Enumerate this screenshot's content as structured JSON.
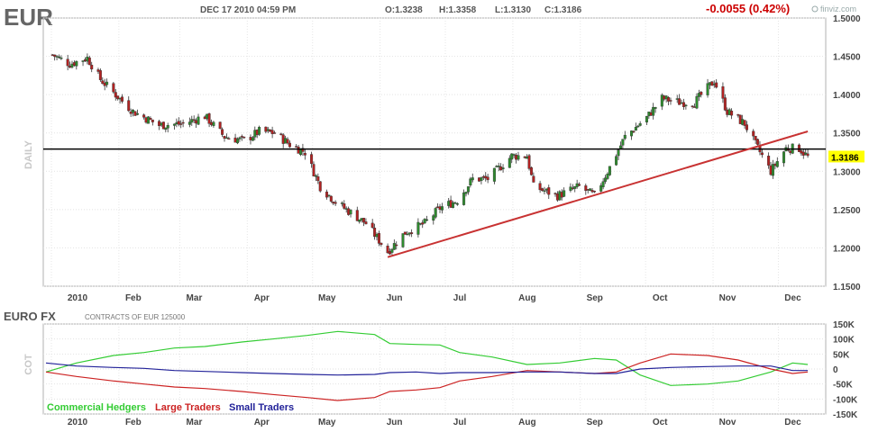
{
  "header": {
    "ticker": "EUR",
    "datetime": "DEC 17 2010 04:59 PM",
    "open": "O:1.3238",
    "high": "H:1.3358",
    "low": "L:1.3130",
    "close": "C:1.3186",
    "change": "-0.0055 (0.42%)",
    "brand": "finviz.com"
  },
  "colors": {
    "up": "#2e8b2e",
    "down": "#b22222",
    "trendline": "#c83232",
    "horizontal": "#000000",
    "commercial": "#33cc33",
    "large": "#cc2222",
    "small": "#222299",
    "change": "#cc0000",
    "price_box": "#ffff00"
  },
  "chart_data": [
    {
      "type": "candlestick",
      "vertical_label": "DAILY",
      "y_ticks": [
        "1.5000",
        "1.4500",
        "1.4000",
        "1.3500",
        "1.3000",
        "1.2500",
        "1.2000",
        "1.1500"
      ],
      "ylim": [
        1.15,
        1.5
      ],
      "x_labels": [
        "2010",
        "Feb",
        "Mar",
        "Apr",
        "May",
        "Jun",
        "Jul",
        "Aug",
        "Sep",
        "Oct",
        "Nov",
        "Dec"
      ],
      "last_price": "1.3186",
      "last_price_value": 1.3186,
      "horizontal_line": 1.329,
      "trendline": {
        "from": {
          "date": "2010-06-07",
          "price": 1.188
        },
        "to": {
          "date": "2010-12-17",
          "price": 1.352
        }
      },
      "anchors": [
        {
          "date": "2010-01-04",
          "price": 1.452
        },
        {
          "date": "2010-01-12",
          "price": 1.44
        },
        {
          "date": "2010-01-20",
          "price": 1.448
        },
        {
          "date": "2010-01-26",
          "price": 1.42
        },
        {
          "date": "2010-02-02",
          "price": 1.4
        },
        {
          "date": "2010-02-10",
          "price": 1.378
        },
        {
          "date": "2010-02-22",
          "price": 1.36
        },
        {
          "date": "2010-03-05",
          "price": 1.362
        },
        {
          "date": "2010-03-15",
          "price": 1.372
        },
        {
          "date": "2010-03-24",
          "price": 1.345
        },
        {
          "date": "2010-04-02",
          "price": 1.34
        },
        {
          "date": "2010-04-09",
          "price": 1.352
        },
        {
          "date": "2010-04-16",
          "price": 1.35
        },
        {
          "date": "2010-04-23",
          "price": 1.335
        },
        {
          "date": "2010-04-30",
          "price": 1.325
        },
        {
          "date": "2010-05-07",
          "price": 1.28
        },
        {
          "date": "2010-05-14",
          "price": 1.26
        },
        {
          "date": "2010-05-20",
          "price": 1.248
        },
        {
          "date": "2010-05-28",
          "price": 1.232
        },
        {
          "date": "2010-06-07",
          "price": 1.195
        },
        {
          "date": "2010-06-15",
          "price": 1.22
        },
        {
          "date": "2010-06-24",
          "price": 1.232
        },
        {
          "date": "2010-07-01",
          "price": 1.252
        },
        {
          "date": "2010-07-09",
          "price": 1.262
        },
        {
          "date": "2010-07-16",
          "price": 1.29
        },
        {
          "date": "2010-07-23",
          "price": 1.29
        },
        {
          "date": "2010-08-03",
          "price": 1.32
        },
        {
          "date": "2010-08-10",
          "price": 1.32
        },
        {
          "date": "2010-08-13",
          "price": 1.28
        },
        {
          "date": "2010-08-24",
          "price": 1.268
        },
        {
          "date": "2010-09-03",
          "price": 1.28
        },
        {
          "date": "2010-09-10",
          "price": 1.268
        },
        {
          "date": "2010-09-17",
          "price": 1.305
        },
        {
          "date": "2010-09-24",
          "price": 1.345
        },
        {
          "date": "2010-10-04",
          "price": 1.37
        },
        {
          "date": "2010-10-11",
          "price": 1.395
        },
        {
          "date": "2010-10-19",
          "price": 1.39
        },
        {
          "date": "2010-10-26",
          "price": 1.39
        },
        {
          "date": "2010-11-04",
          "price": 1.418
        },
        {
          "date": "2010-11-10",
          "price": 1.378
        },
        {
          "date": "2010-11-18",
          "price": 1.362
        },
        {
          "date": "2010-11-23",
          "price": 1.335
        },
        {
          "date": "2010-11-30",
          "price": 1.3
        },
        {
          "date": "2010-12-07",
          "price": 1.33
        },
        {
          "date": "2010-12-13",
          "price": 1.33
        },
        {
          "date": "2010-12-17",
          "price": 1.3186
        }
      ]
    },
    {
      "type": "line",
      "title": "EURO FX",
      "subtitle": "CONTRACTS OF EUR 125000",
      "vertical_label": "COT",
      "y_ticks": [
        "150K",
        "100K",
        "50K",
        "0",
        "-50K",
        "-100K",
        "-150K"
      ],
      "ylim": [
        -150000,
        150000
      ],
      "x_labels": [
        "2010",
        "Feb",
        "Mar",
        "Apr",
        "May",
        "Jun",
        "Jul",
        "Aug",
        "Sep",
        "Oct",
        "Nov",
        "Dec"
      ],
      "series": [
        {
          "name": "Commercial Hedgers",
          "color_key": "commercial",
          "points": [
            [
              "2010-01-01",
              -10000
            ],
            [
              "2010-01-15",
              20000
            ],
            [
              "2010-02-01",
              45000
            ],
            [
              "2010-02-15",
              55000
            ],
            [
              "2010-03-01",
              70000
            ],
            [
              "2010-03-15",
              75000
            ],
            [
              "2010-04-01",
              90000
            ],
            [
              "2010-04-15",
              100000
            ],
            [
              "2010-05-01",
              112000
            ],
            [
              "2010-05-15",
              125000
            ],
            [
              "2010-06-01",
              115000
            ],
            [
              "2010-06-08",
              85000
            ],
            [
              "2010-06-20",
              82000
            ],
            [
              "2010-07-01",
              80000
            ],
            [
              "2010-07-10",
              55000
            ],
            [
              "2010-07-25",
              40000
            ],
            [
              "2010-08-10",
              15000
            ],
            [
              "2010-08-25",
              20000
            ],
            [
              "2010-09-10",
              35000
            ],
            [
              "2010-09-20",
              30000
            ],
            [
              "2010-10-01",
              -20000
            ],
            [
              "2010-10-15",
              -55000
            ],
            [
              "2010-11-01",
              -50000
            ],
            [
              "2010-11-15",
              -40000
            ],
            [
              "2010-11-30",
              -10000
            ],
            [
              "2010-12-10",
              20000
            ],
            [
              "2010-12-17",
              15000
            ]
          ]
        },
        {
          "name": "Large Traders",
          "color_key": "large",
          "points": [
            [
              "2010-01-01",
              -10000
            ],
            [
              "2010-01-15",
              -25000
            ],
            [
              "2010-02-01",
              -40000
            ],
            [
              "2010-02-15",
              -50000
            ],
            [
              "2010-03-01",
              -60000
            ],
            [
              "2010-03-15",
              -65000
            ],
            [
              "2010-04-01",
              -75000
            ],
            [
              "2010-04-15",
              -85000
            ],
            [
              "2010-05-01",
              -95000
            ],
            [
              "2010-05-15",
              -105000
            ],
            [
              "2010-06-01",
              -95000
            ],
            [
              "2010-06-08",
              -75000
            ],
            [
              "2010-06-20",
              -70000
            ],
            [
              "2010-07-01",
              -62000
            ],
            [
              "2010-07-10",
              -40000
            ],
            [
              "2010-07-25",
              -25000
            ],
            [
              "2010-08-10",
              -5000
            ],
            [
              "2010-08-25",
              -10000
            ],
            [
              "2010-09-10",
              -15000
            ],
            [
              "2010-09-20",
              -10000
            ],
            [
              "2010-10-01",
              20000
            ],
            [
              "2010-10-15",
              50000
            ],
            [
              "2010-11-01",
              45000
            ],
            [
              "2010-11-15",
              30000
            ],
            [
              "2010-11-30",
              0
            ],
            [
              "2010-12-10",
              -15000
            ],
            [
              "2010-12-17",
              -10000
            ]
          ]
        },
        {
          "name": "Small Traders",
          "color_key": "small",
          "points": [
            [
              "2010-01-01",
              20000
            ],
            [
              "2010-01-15",
              10000
            ],
            [
              "2010-02-01",
              5000
            ],
            [
              "2010-02-15",
              2000
            ],
            [
              "2010-03-01",
              -5000
            ],
            [
              "2010-03-15",
              -8000
            ],
            [
              "2010-04-01",
              -12000
            ],
            [
              "2010-04-15",
              -15000
            ],
            [
              "2010-05-01",
              -18000
            ],
            [
              "2010-05-15",
              -20000
            ],
            [
              "2010-06-01",
              -18000
            ],
            [
              "2010-06-08",
              -12000
            ],
            [
              "2010-06-20",
              -10000
            ],
            [
              "2010-07-01",
              -15000
            ],
            [
              "2010-07-10",
              -12000
            ],
            [
              "2010-07-25",
              -12000
            ],
            [
              "2010-08-10",
              -10000
            ],
            [
              "2010-08-25",
              -10000
            ],
            [
              "2010-09-10",
              -15000
            ],
            [
              "2010-09-20",
              -15000
            ],
            [
              "2010-10-01",
              0
            ],
            [
              "2010-10-15",
              5000
            ],
            [
              "2010-11-01",
              8000
            ],
            [
              "2010-11-15",
              10000
            ],
            [
              "2010-11-30",
              10000
            ],
            [
              "2010-12-10",
              -5000
            ],
            [
              "2010-12-17",
              -5000
            ]
          ]
        }
      ]
    }
  ]
}
